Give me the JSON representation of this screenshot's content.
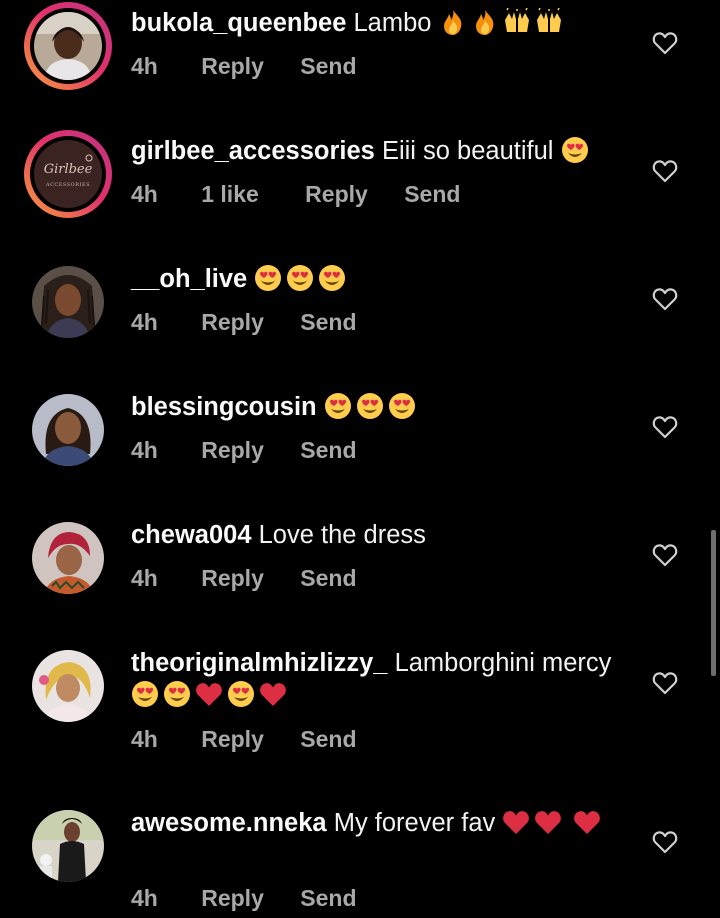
{
  "comments": [
    {
      "username": "bukola_queenbee",
      "text": "Lambo",
      "emojis": [
        "fire-emoji",
        "fire-emoji",
        "raising-hands-emoji",
        "raising-hands-emoji"
      ],
      "time": "4h",
      "likes": "",
      "reply_label": "Reply",
      "send_label": "Send",
      "story_ring": true,
      "avatar": "girl-photo"
    },
    {
      "username": "girlbee_accessories",
      "text": "Eiii so beautiful",
      "emojis": [
        "heart-eyes-emoji"
      ],
      "time": "4h",
      "likes": "1 like",
      "reply_label": "Reply",
      "send_label": "Send",
      "story_ring": true,
      "avatar": "brand-logo",
      "avatar_logo_text": "Girlbee",
      "avatar_logo_subtext": "ACCESSORIES"
    },
    {
      "username": "__oh_live",
      "text": "",
      "emojis": [
        "heart-eyes-emoji",
        "heart-eyes-emoji",
        "heart-eyes-emoji"
      ],
      "time": "4h",
      "likes": "",
      "reply_label": "Reply",
      "send_label": "Send",
      "story_ring": false,
      "avatar": "woman-braids-photo"
    },
    {
      "username": "blessingcousin",
      "text": "",
      "emojis": [
        "heart-eyes-emoji",
        "heart-eyes-emoji",
        "heart-eyes-emoji"
      ],
      "time": "4h",
      "likes": "",
      "reply_label": "Reply",
      "send_label": "Send",
      "story_ring": false,
      "avatar": "woman-photo"
    },
    {
      "username": "chewa004",
      "text": "Love the dress",
      "emojis": [],
      "time": "4h",
      "likes": "",
      "reply_label": "Reply",
      "send_label": "Send",
      "story_ring": false,
      "avatar": "woman-headwrap-photo"
    },
    {
      "username": "theoriginalmhizlizzy_",
      "text": "Lamborghini mercy",
      "emojis": [
        "heart-eyes-emoji",
        "heart-eyes-emoji",
        "red-heart-emoji",
        "heart-eyes-emoji",
        "red-heart-emoji"
      ],
      "time": "4h",
      "likes": "",
      "reply_label": "Reply",
      "send_label": "Send",
      "story_ring": false,
      "avatar": "woman-blonde-photo"
    },
    {
      "username": "awesome.nneka",
      "text": "My forever fav",
      "emojis": [
        "red-heart-emoji",
        "red-heart-emoji",
        "red-heart-emoji"
      ],
      "time": "4h",
      "likes": "",
      "reply_label": "Reply",
      "send_label": "Send",
      "story_ring": false,
      "avatar": "woman-fullbody-photo"
    }
  ],
  "colors": {
    "background": "#000000",
    "text": "#f2f2f2",
    "meta": "#a8a8a8",
    "heart_outline": "#cfcfcf",
    "ring_start": "#f9a13a",
    "ring_end": "#c13584"
  }
}
